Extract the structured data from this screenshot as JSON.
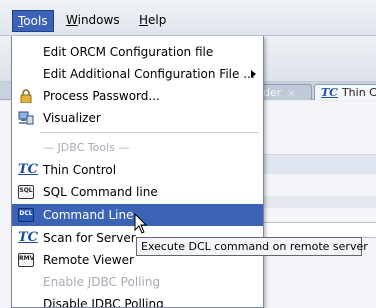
{
  "menubar": {
    "items": [
      {
        "label": "Tools",
        "mnemonic_first": "T",
        "rest": "ools"
      },
      {
        "label": "Windows",
        "mnemonic_first": "W",
        "rest": "indows"
      },
      {
        "label": "Help",
        "mnemonic_first": "H",
        "rest": "elp"
      }
    ]
  },
  "background": {
    "tabs": [
      {
        "label": "der",
        "close": "×"
      },
      {
        "label": "Thin C",
        "icon": "TC"
      }
    ]
  },
  "tools_menu": {
    "items": [
      {
        "label": "Edit ORCM Configuration file",
        "icon": ""
      },
      {
        "label": "Edit Additional Configuration File ...",
        "icon": "",
        "submenu": true
      },
      {
        "label": "Process Password...",
        "icon": "lock-icon"
      },
      {
        "label": "Visualizer",
        "icon": "visualizer-icon"
      },
      {
        "label": "— JDBC Tools —",
        "disabled": true
      },
      {
        "label": "Thin Control",
        "icon": "TC"
      },
      {
        "label": "SQL Command line",
        "icon": "SQL"
      },
      {
        "label": "Command Line",
        "icon": "DCL",
        "highlighted": true
      },
      {
        "label": "Scan for Server",
        "icon": "TC"
      },
      {
        "label": "Remote Viewer",
        "icon": "RMV"
      },
      {
        "label": "Enable JDBC Polling",
        "disabled": true
      },
      {
        "label": "Disable JDBC Polling",
        "disabled": false
      }
    ]
  },
  "tooltip": {
    "text": "Execute DCL command on remote server"
  },
  "colors": {
    "highlight": "#3c64b6",
    "menubar_active": "#3a63b8",
    "disabled_text": "#a6abb3"
  }
}
